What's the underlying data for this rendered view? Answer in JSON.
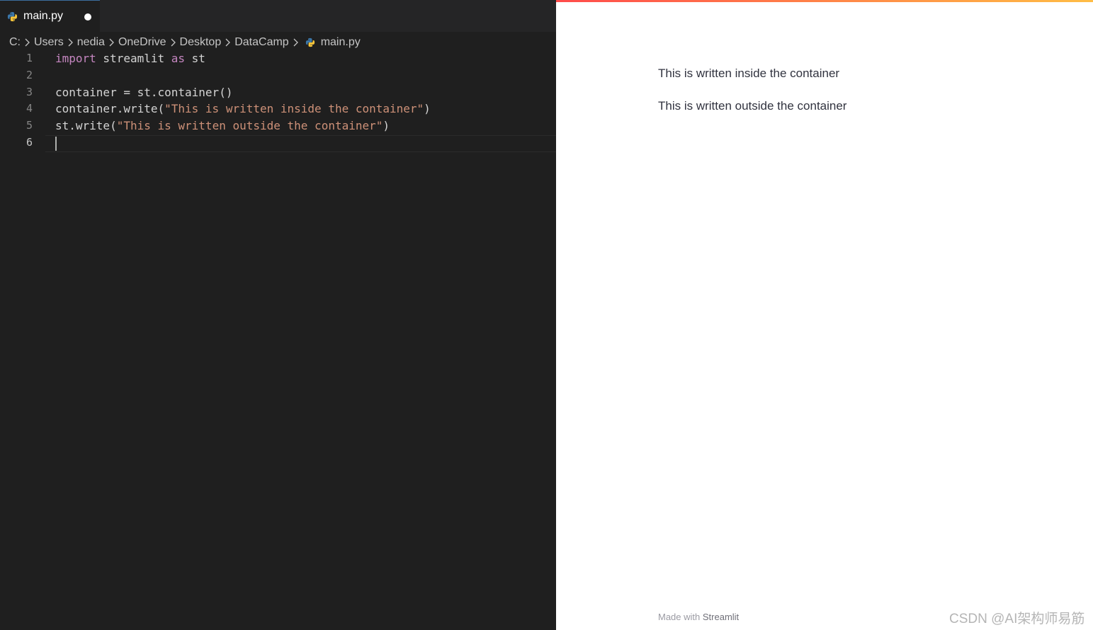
{
  "editor": {
    "tab": {
      "title": "main.py"
    },
    "breadcrumb": {
      "segments": [
        "C:",
        "Users",
        "nedia",
        "OneDrive",
        "Desktop",
        "DataCamp"
      ],
      "file": "main.py"
    },
    "line_numbers": [
      "1",
      "2",
      "3",
      "4",
      "5",
      "6"
    ],
    "code": {
      "l1": {
        "kw1": "import",
        "t1": " streamlit ",
        "kw2": "as",
        "t2": " st"
      },
      "l3": "container = st.container()",
      "l4": {
        "pre": "container.write(",
        "str": "\"This is written inside the container\"",
        "post": ")"
      },
      "l5": {
        "pre": "st.write(",
        "str": "\"This is written outside the container\"",
        "post": ")"
      }
    },
    "colors": {
      "background": "#1f1f1f",
      "keyword": "#c586c0",
      "string": "#ce9178",
      "text": "#d4d4d4"
    }
  },
  "app": {
    "texts": [
      "This is written inside the container",
      "This is written outside the container"
    ],
    "footer": {
      "prefix": "Made with ",
      "brand": "Streamlit"
    }
  },
  "watermark": "CSDN @AI架构师易筋"
}
